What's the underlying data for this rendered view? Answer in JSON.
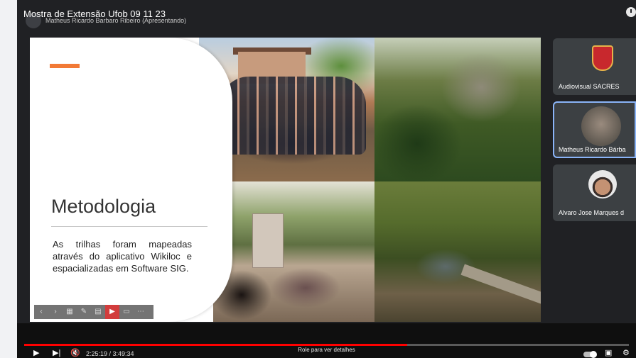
{
  "video": {
    "title": "Mostra de Extensão Ufob 09 11 23"
  },
  "meet": {
    "presenter_label": "Matheus Ricardo Barbaro Ribeiro (Apresentando)"
  },
  "slide": {
    "title": "Metodologia",
    "body": "As trilhas foram mapeadas através do aplicativo Wikiloc e espacializadas em Software SIG.",
    "accent_color": "#f27a36"
  },
  "participants": [
    {
      "name": "Audiovisual SACRES"
    },
    {
      "name": "Matheus Ricardo Bárba"
    },
    {
      "name": "Alvaro Jose Marques d"
    }
  ],
  "player": {
    "time": "2:25:19 / 3:49:34",
    "scroll_hint": "Role para ver detalhes",
    "progress": 0.633,
    "progress_color": "#ff0000"
  }
}
